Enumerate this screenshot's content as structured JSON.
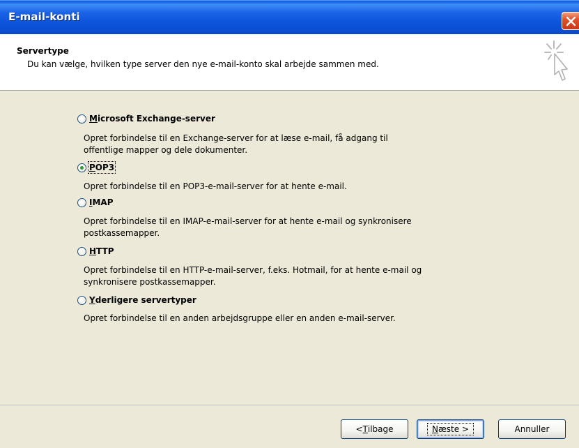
{
  "window": {
    "title": "E-mail-konti"
  },
  "header": {
    "title": "Servertype",
    "subtitle": "Du kan vælge, hvilken type server den nye e-mail-konto skal arbejde sammen med."
  },
  "options": [
    {
      "key_char": "M",
      "label_rest": "icrosoft Exchange-server",
      "selected": false,
      "desc1": "Opret forbindelse til en Exchange-server for at læse e-mail, få adgang til",
      "desc2": "offentlige mapper og dele dokumenter."
    },
    {
      "key_char": "P",
      "label_rest": "OP3",
      "selected": true,
      "desc1": "Opret forbindelse til en POP3-e-mail-server for at hente e-mail.",
      "desc2": ""
    },
    {
      "key_char": "I",
      "label_rest": "MAP",
      "selected": false,
      "desc1": "Opret forbindelse til en IMAP-e-mail-server for at hente e-mail og synkronisere",
      "desc2": "postkassemapper."
    },
    {
      "key_char": "H",
      "label_rest": "TTP",
      "selected": false,
      "desc1": "Opret forbindelse til en HTTP-e-mail-server, f.eks. Hotmail, for at hente e-mail og",
      "desc2": "synkronisere postkassemapper."
    },
    {
      "key_char": "Y",
      "label_rest": "derligere servertyper",
      "selected": false,
      "desc1": "Opret forbindelse til en anden arbejdsgruppe eller en anden e-mail-server.",
      "desc2": ""
    }
  ],
  "buttons": {
    "back": {
      "pre": "< ",
      "key": "T",
      "post": "ilbage"
    },
    "next": {
      "pre": "",
      "key": "N",
      "post": "æste >"
    },
    "cancel": {
      "label": "Annuller"
    }
  },
  "colors": {
    "titlebar": "#0a52d8",
    "dialog_bg": "#ece9d8",
    "radio_dot": "#2f9a2f",
    "close_button": "#d9482a"
  },
  "icons": [
    "close-icon",
    "wizard-cursor-icon",
    "radio-icon"
  ]
}
